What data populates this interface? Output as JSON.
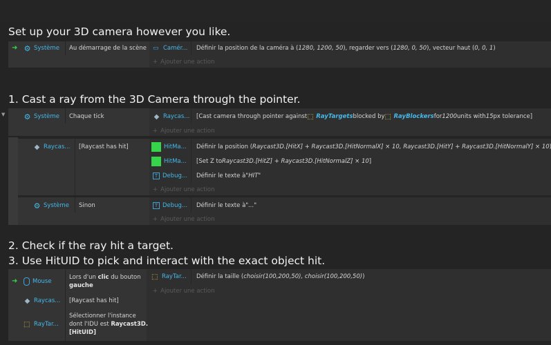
{
  "comments": [
    "Set up your 3D camera however you like.",
    "1. Cast a ray from the 3D Camera through the pointer.",
    "2. Check if the ray hit a target.",
    "3. Use HitUID to pick and interact with the exact object hit."
  ],
  "add_action_label": "Ajouter une action",
  "event1": {
    "cond_object": "Système",
    "cond_text": "Au démarrage de la scène",
    "act_object": "Camér...",
    "act_text": {
      "p1": "Définir la position de la caméra à (",
      "v1": "1280, 1200, 50",
      "p2": "), regarder vers (",
      "v2": "1280, 0, 50",
      "p3": "), vecteur haut (",
      "v3": "0, 0, 1",
      "p4": ")"
    }
  },
  "event2": {
    "cond_object": "Système",
    "cond_text": "Chaque tick",
    "act_object": "Raycas...",
    "act_text": {
      "p1": "[Cast camera through pointer against ",
      "t1": "RayTargets",
      "p2": " blocked by ",
      "t2": "RayBlockers",
      "p3": " for ",
      "v1": "1200",
      "p4": " units with ",
      "v2": "15",
      "p5": " px tolerance]"
    }
  },
  "sub1": {
    "cond_object": "Raycas...",
    "cond_text": "[Raycast has hit]",
    "actions": [
      {
        "object": "HitMa...",
        "prefix": "Définir la position (",
        "value": "Raycast3D.[HitX] + Raycast3D.[HitNormalX] × 10, Raycast3D.[HitY] + Raycast3D.[HitNormalY] × 10",
        "suffix": ")"
      },
      {
        "object": "HitMa...",
        "prefix": "[Set Z to ",
        "value": "Raycast3D.[HitZ] + Raycast3D.[HitNormalZ] × 10",
        "suffix": "]"
      },
      {
        "object": "Debug...",
        "prefix": "Définir le texte à ",
        "value": "\"HIT\"",
        "suffix": ""
      }
    ]
  },
  "sub2": {
    "cond_object": "Système",
    "cond_text": "Sinon",
    "act_object": "Debug...",
    "act_prefix": "Définir le texte à ",
    "act_value": "\"...\""
  },
  "event3": {
    "conditions": [
      {
        "object": "Mouse",
        "line1_a": "Lors d'un ",
        "line1_b": "clic",
        "line1_c": " du bouton",
        "line2": "gauche"
      },
      {
        "object": "Raycas...",
        "text": "[Raycast has hit]"
      },
      {
        "object": "RayTar...",
        "line1": "Sélectionner l'instance",
        "line2a": "dont l'IDU est ",
        "line2b": "Raycast3D.",
        "line3": "[HitUID]"
      }
    ],
    "act_object": "RayTar...",
    "act_prefix": "Définir la taille (",
    "act_value": "choisir(100,200,50), choisir(100,200,50)",
    "act_suffix": ")"
  },
  "icons": {
    "gear": "gear-icon",
    "cube": "raycast-cube-icon",
    "camera": "camera-icon",
    "sprite": "hitmarker-sprite-icon",
    "text": "text-object-icon",
    "mouse": "mouse-icon",
    "group": "object-group-icon",
    "arrow": "trigger-arrow-icon",
    "collapse": "collapse-triangle-icon"
  },
  "colors": {
    "object_link": "#46b8e8",
    "green_sprite": "#36d44a",
    "trigger_arrow": "#36d44a"
  }
}
